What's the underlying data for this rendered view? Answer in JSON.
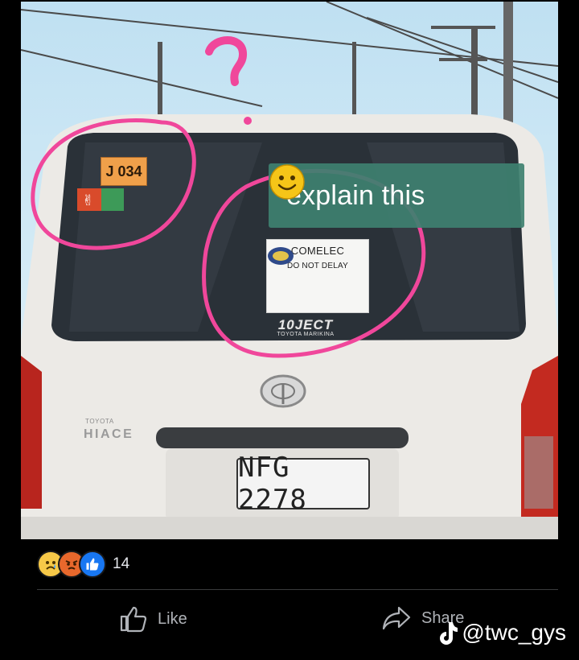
{
  "photo": {
    "caption": "explain this",
    "caption_emoji": "smiling-face",
    "sign_line1": "COMELEC",
    "sign_line2": "DO NOT DELAY",
    "dealer_logo": "TOYOTA MARIKINA",
    "dealer_name_stylized": "10JECT",
    "sticker_code": "J 034",
    "model_brand": "TOYOTA",
    "model_name": "HIACE",
    "plate": "NFG 2278",
    "annotation_mark": "?"
  },
  "post": {
    "reactions": [
      "sad-reaction",
      "angry-reaction",
      "like-reaction"
    ],
    "reaction_count": "14",
    "like_label": "Like",
    "share_label": "Share"
  },
  "watermark": {
    "handle": "@twc_gys"
  },
  "colors": {
    "background": "#000000",
    "annotation_pink": "#f0479b",
    "caption_bg": "#3e8070",
    "van_white": "#eceae6"
  }
}
